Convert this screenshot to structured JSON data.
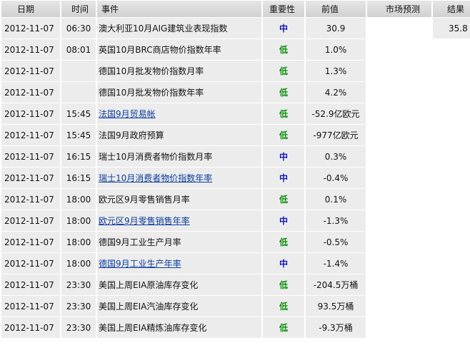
{
  "headers": {
    "date": "日期",
    "time": "时间",
    "event": "事件",
    "importance": "重要性",
    "previous": "前值",
    "forecast": "市场预测",
    "actual": "结果"
  },
  "rows": [
    {
      "date": "2012-11-07",
      "time": "06:30",
      "event": "澳大利亚10月AIG建筑业表现指数",
      "link": false,
      "importance": "中",
      "level": "mid",
      "previous": "30.9",
      "forecast": "",
      "actual": "35.8"
    },
    {
      "date": "2012-11-07",
      "time": "08:01",
      "event": "英国10月BRC商店物价指数年率",
      "link": false,
      "importance": "低",
      "level": "low",
      "previous": "1.0%",
      "forecast": "",
      "actual": ""
    },
    {
      "date": "2012-11-07",
      "time": "",
      "event": "德国10月批发物价指数月率",
      "link": false,
      "importance": "低",
      "level": "low",
      "previous": "1.3%",
      "forecast": "",
      "actual": ""
    },
    {
      "date": "2012-11-07",
      "time": "",
      "event": "德国10月批发物价指数年率",
      "link": false,
      "importance": "低",
      "level": "low",
      "previous": "4.2%",
      "forecast": "",
      "actual": ""
    },
    {
      "date": "2012-11-07",
      "time": "15:45",
      "event": "法国9月贸易帐",
      "link": true,
      "importance": "低",
      "level": "low",
      "previous": "-52.9亿欧元",
      "forecast": "",
      "actual": ""
    },
    {
      "date": "2012-11-07",
      "time": "15:45",
      "event": "法国9月政府预算",
      "link": false,
      "importance": "低",
      "level": "low",
      "previous": "-977亿欧元",
      "forecast": "",
      "actual": ""
    },
    {
      "date": "2012-11-07",
      "time": "16:15",
      "event": "瑞士10月消费者物价指数月率",
      "link": false,
      "importance": "中",
      "level": "mid",
      "previous": "0.3%",
      "forecast": "",
      "actual": ""
    },
    {
      "date": "2012-11-07",
      "time": "16:15",
      "event": "瑞士10月消费者物价指数年率",
      "link": true,
      "importance": "中",
      "level": "mid",
      "previous": "-0.4%",
      "forecast": "",
      "actual": ""
    },
    {
      "date": "2012-11-07",
      "time": "18:00",
      "event": "欧元区9月零售销售月率",
      "link": false,
      "importance": "低",
      "level": "low",
      "previous": "0.1%",
      "forecast": "",
      "actual": ""
    },
    {
      "date": "2012-11-07",
      "time": "18:00",
      "event": "欧元区9月零售销售年率",
      "link": true,
      "importance": "中",
      "level": "mid",
      "previous": "-1.3%",
      "forecast": "",
      "actual": ""
    },
    {
      "date": "2012-11-07",
      "time": "18:00",
      "event": "德国9月工业生产月率",
      "link": false,
      "importance": "低",
      "level": "low",
      "previous": "-0.5%",
      "forecast": "",
      "actual": ""
    },
    {
      "date": "2012-11-07",
      "time": "18:00",
      "event": "德国9月工业生产年率",
      "link": true,
      "importance": "中",
      "level": "mid",
      "previous": "-1.4%",
      "forecast": "",
      "actual": ""
    },
    {
      "date": "2012-11-07",
      "time": "23:30",
      "event": "美国上周EIA原油库存变化",
      "link": false,
      "importance": "低",
      "level": "low",
      "previous": "-204.5万桶",
      "forecast": "",
      "actual": ""
    },
    {
      "date": "2012-11-07",
      "time": "23:30",
      "event": "美国上周EIA汽油库存变化",
      "link": false,
      "importance": "低",
      "level": "low",
      "previous": "93.5万桶",
      "forecast": "",
      "actual": ""
    },
    {
      "date": "2012-11-07",
      "time": "23:30",
      "event": "美国上周EIA精炼油库存变化",
      "link": false,
      "importance": "低",
      "level": "low",
      "previous": "-9.3万桶",
      "forecast": "",
      "actual": ""
    }
  ],
  "colors": {
    "importance_low": "#0a8f0a",
    "importance_mid": "#1414b8",
    "link": "#0b3c9e",
    "row_bg": "#ececec",
    "header_bg": "#d8d8d8"
  }
}
